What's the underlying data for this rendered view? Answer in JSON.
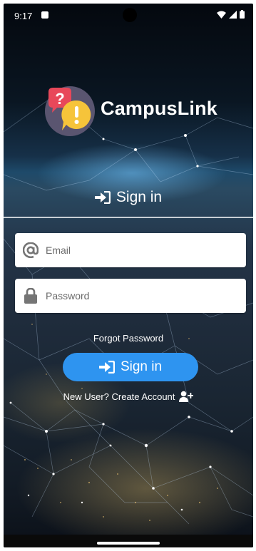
{
  "status_bar": {
    "time": "9:17",
    "icons": [
      "notification-icon",
      "wifi-icon",
      "signal-icon",
      "battery-icon"
    ]
  },
  "app": {
    "title": "CampusLink",
    "logo_icon": "chat-question-exclamation-logo"
  },
  "signin_heading": {
    "label": "Sign in",
    "icon": "sign-in-icon"
  },
  "form": {
    "email": {
      "value": "",
      "placeholder": "Email",
      "icon": "at-icon"
    },
    "password": {
      "value": "",
      "placeholder": "Password",
      "icon": "lock-icon"
    }
  },
  "forgot_password_label": "Forgot Password",
  "signin_button": {
    "label": "Sign in",
    "icon": "sign-in-icon"
  },
  "create_account": {
    "label": "New User? Create Account",
    "icon": "user-plus-icon"
  },
  "colors": {
    "accent": "#2e94f0",
    "logo_red": "#e8485a",
    "logo_yellow": "#f6c43a",
    "logo_bg": "#5a5570"
  }
}
